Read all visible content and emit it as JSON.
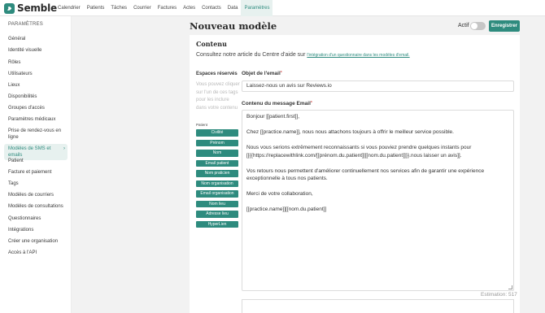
{
  "app": {
    "brand": "Semble"
  },
  "nav": {
    "items": [
      "Calendrier",
      "Patients",
      "Tâches",
      "Courrier",
      "Factures",
      "Actes",
      "Contacts",
      "Data",
      "Paramètres"
    ],
    "active_index": 8
  },
  "sidebar": {
    "title": "PARAMÈTRES",
    "items": [
      "Général",
      "Identité visuelle",
      "Rôles",
      "Utilisateurs",
      "Lieux",
      "Disponibilités",
      "Groupes d'accès",
      "Paramètres médicaux",
      "Prise de rendez-vous en ligne",
      "Modèles de SMS et emails",
      "Patient",
      "Facture et paiement",
      "Tags",
      "Modèles de courriers",
      "Modèles de consultations",
      "Questionnaires",
      "Intégrations",
      "Créer une organisation",
      "Accès à l'API"
    ],
    "active_index": 9
  },
  "header": {
    "title": "Nouveau modèle",
    "active_label": "Actif",
    "active_on": false,
    "save_label": "Enregistrer"
  },
  "content": {
    "title": "Contenu",
    "help_text": "Consultez notre article du Centre d'aide sur",
    "help_link": "l'intégration d'un questionnaire dans les modèles d'email.",
    "reserved_title": "Espaces réservés",
    "reserved_desc": "Vous pouvez cliquer sur l'un de ces tags pour les inclure dans votre contenu",
    "patient_label": "Patient",
    "tags": [
      "Civilité",
      "Prénom",
      "Nom",
      "Email patient",
      "Nom praticien",
      "Nom organisation",
      "Email organisation",
      "Nom lieu",
      "Adresse lieu",
      "HyperLien"
    ],
    "subject_label": "Objet de l'email",
    "required_mark": "*",
    "subject_value": "Laissez-nous un avis sur Reviews.io",
    "body_label": "Contenu du message Email",
    "body_lines": [
      "Bonjour [[patient.first]],",
      "",
      "Chez [[practice.name]], nous nous attachons toujours à offrir le meilleur service possible.",
      "",
      "Nous vous serions extrêmement reconnaissants si vous pouviez prendre quelques instants pour",
      "[[{{https://replacewithlink.com/[[prénom.du.patient]][[nom.du.patient]]}}.nous laisser un avis]].",
      "",
      "Vos retours nous permettent d'améliorer continuellement nos services afin de garantir une expérience",
      "exceptionnelle à tous nos patients.",
      "",
      "Merci de votre collaboration,",
      "",
      "[[practice.name]][[nom.du.patient]]"
    ],
    "estimation": "Estimation: 517"
  },
  "colors": {
    "accent": "#2e8b7e",
    "accent_light": "#e7f1ef",
    "background": "#f2f2f2"
  }
}
